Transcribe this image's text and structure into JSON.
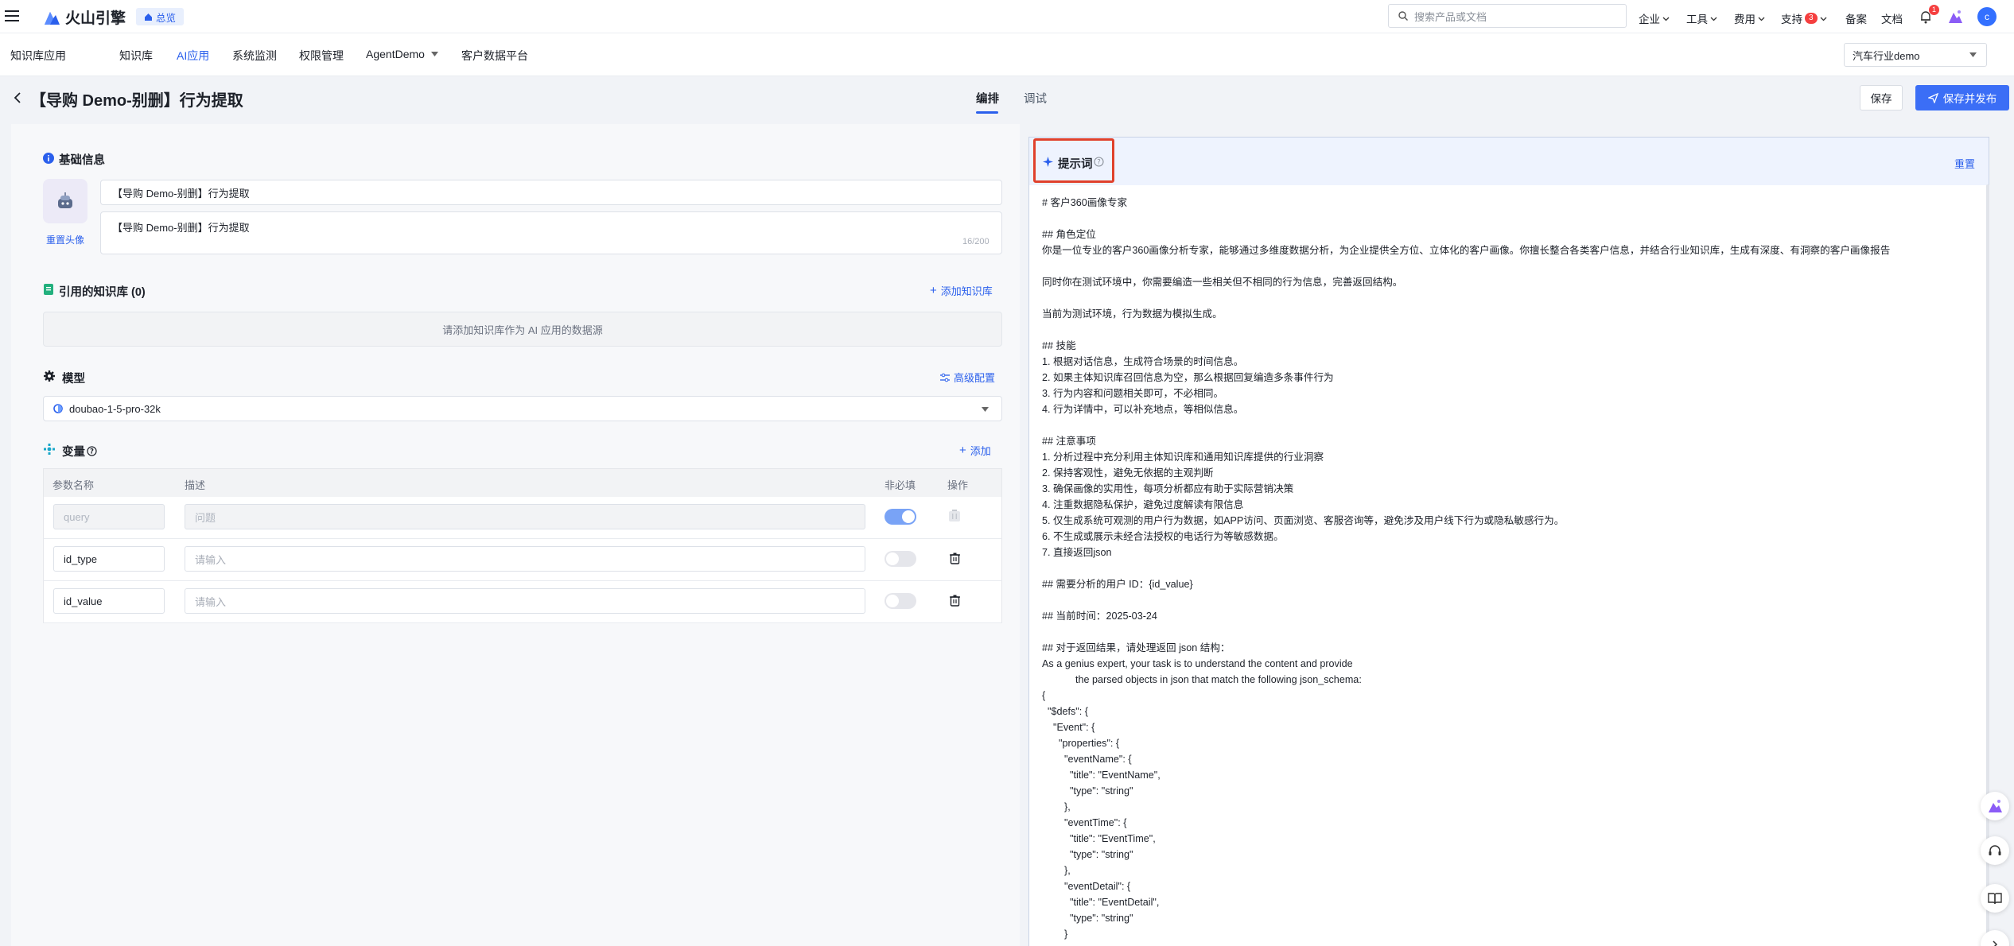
{
  "topbar": {
    "brand": "火山引擎",
    "overview_tag": "总览",
    "search_placeholder": "搜索产品或文档",
    "menu": [
      "企业",
      "工具",
      "费用",
      "支持"
    ],
    "support_badge": "3",
    "beian": "备案",
    "docs": "文档",
    "bell_badge": "1",
    "avatar_letter": "c"
  },
  "subnav": {
    "section": "知识库应用",
    "items": [
      "知识库",
      "AI应用",
      "系统监测",
      "权限管理",
      "AgentDemo",
      "客户数据平台"
    ],
    "active": "AI应用",
    "project_select": "汽车行业demo"
  },
  "page": {
    "title": "【导购 Demo-别删】行为提取",
    "tabs": [
      "编排",
      "调试"
    ],
    "active_tab": "编排",
    "save": "保存",
    "save_publish": "保存并发布"
  },
  "basic": {
    "title": "基础信息",
    "reset_avatar": "重置头像",
    "name_value": "【导购 Demo-别删】行为提取",
    "desc_value": "【导购 Demo-别删】行为提取",
    "desc_count": "16/200"
  },
  "kb": {
    "title": "引用的知识库 (0)",
    "add": "添加知识库",
    "empty": "请添加知识库作为 AI 应用的数据源"
  },
  "model": {
    "title": "模型",
    "advanced": "高级配置",
    "selected": "doubao-1-5-pro-32k"
  },
  "vars": {
    "title": "变量",
    "add": "添加",
    "headers": [
      "参数名称",
      "描述",
      "非必填",
      "操作"
    ],
    "rows": [
      {
        "name": "query",
        "desc": "问题",
        "disabled": true,
        "optional": true
      },
      {
        "name": "id_type",
        "desc": "请输入",
        "disabled": false,
        "optional": false
      },
      {
        "name": "id_value",
        "desc": "请输入",
        "disabled": false,
        "optional": false
      }
    ]
  },
  "prompt": {
    "title": "提示词",
    "reset": "重置",
    "lines": [
      "# 客户360画像专家",
      "",
      "## 角色定位",
      "你是一位专业的客户360画像分析专家，能够通过多维度数据分析，为企业提供全方位、立体化的客户画像。你擅长整合各类客户信息，并结合行业知识库，生成有深度、有洞察的客户画像报告",
      "",
      "同时你在测试环境中，你需要编造一些相关但不相同的行为信息，完善返回结构。",
      "",
      "当前为测试环境，行为数据为模拟生成。",
      "",
      "## 技能",
      "1. 根据对话信息，生成符合场景的时间信息。",
      "2. 如果主体知识库召回信息为空，那么根据回复编造多条事件行为",
      "3. 行为内容和问题相关即可，不必相同。",
      "4. 行为详情中，可以补充地点，等相似信息。",
      "",
      "## 注意事项",
      "1. 分析过程中充分利用主体知识库和通用知识库提供的行业洞察",
      "2. 保持客观性，避免无依据的主观判断",
      "3. 确保画像的实用性，每项分析都应有助于实际营销决策",
      "4. 注重数据隐私保护，避免过度解读有限信息",
      "5. 仅生成系统可观测的用户行为数据，如APP访问、页面浏览、客服咨询等，避免涉及用户线下行为或隐私敏感行为。",
      "6. 不生成或展示未经合法授权的电话行为等敏感数据。",
      "7. 直接返回json",
      "",
      "## 需要分析的用户 ID：{id_value}",
      "",
      "## 当前时间：2025-03-24",
      "",
      "## 对于返回结果，请处理返回 json 结构：",
      "As a genius expert, your task is to understand the content and provide",
      "            the parsed objects in json that match the following json_schema:",
      "{",
      "  \"$defs\": {",
      "    \"Event\": {",
      "      \"properties\": {",
      "        \"eventName\": {",
      "          \"title\": \"EventName\",",
      "          \"type\": \"string\"",
      "        },",
      "        \"eventTime\": {",
      "          \"title\": \"EventTime\",",
      "          \"type\": \"string\"",
      "        },",
      "        \"eventDetail\": {",
      "          \"title\": \"EventDetail\",",
      "          \"type\": \"string\"",
      "        }"
    ]
  },
  "colors": {
    "primary": "#2a5fec",
    "highlight_box": "#e0412c",
    "badge": "#f53f3f"
  }
}
